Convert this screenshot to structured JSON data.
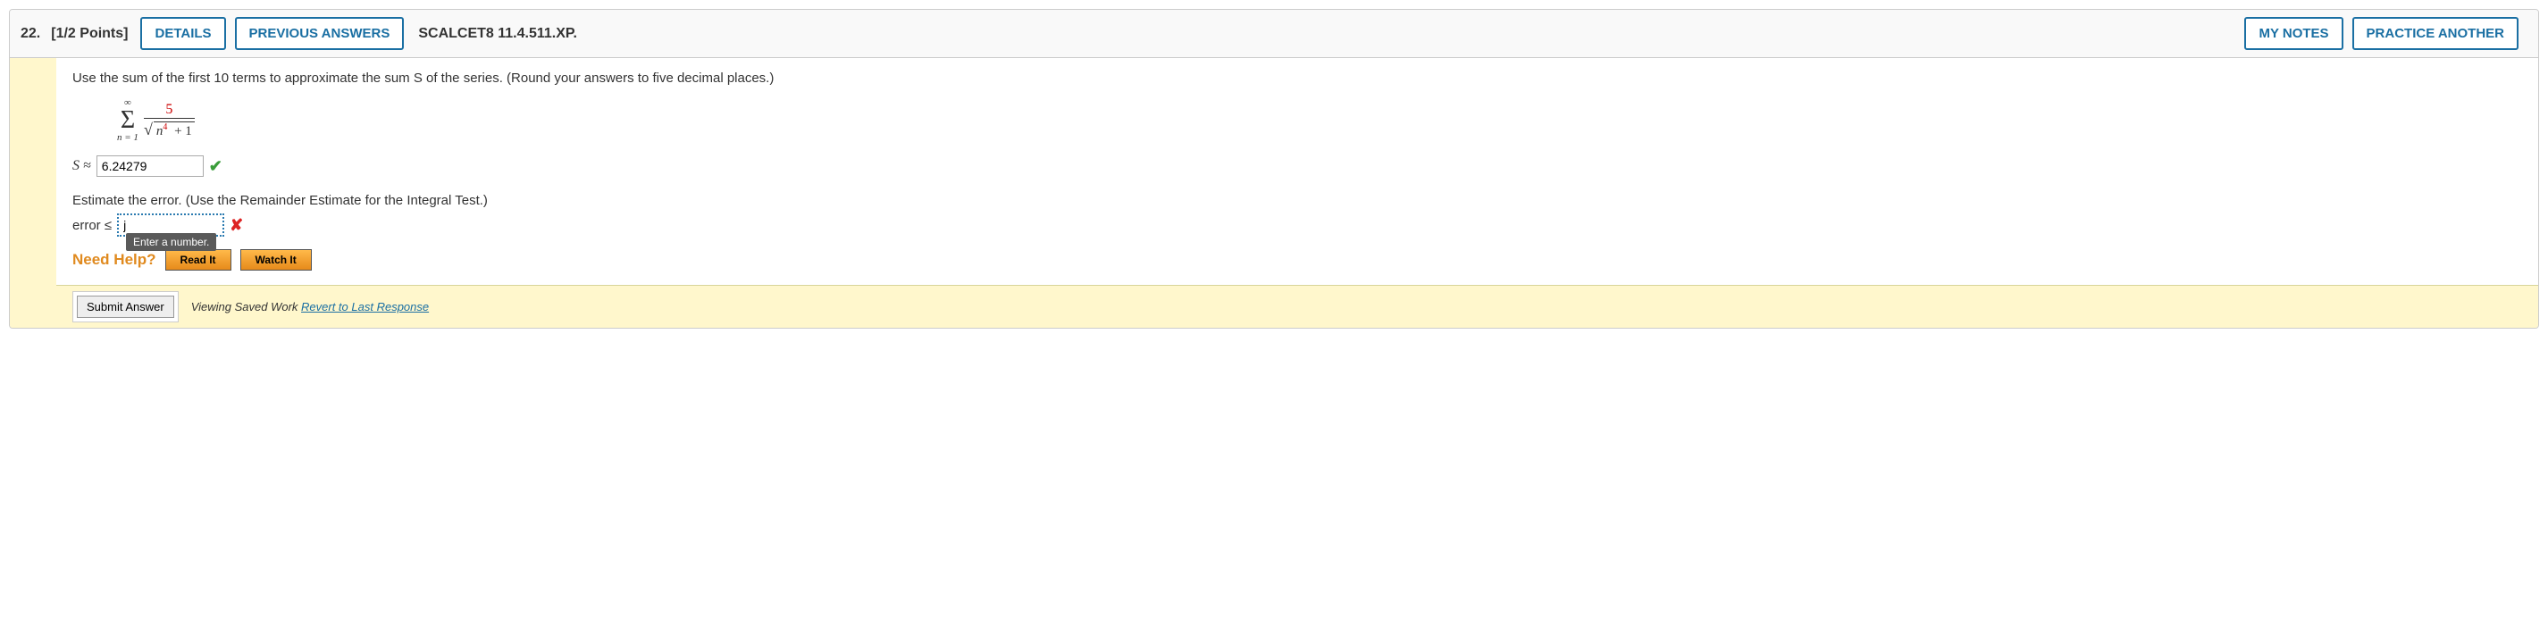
{
  "header": {
    "number": "22.",
    "points": "[1/2 Points]",
    "details": "DETAILS",
    "previous": "PREVIOUS ANSWERS",
    "reference": "SCALCET8 11.4.511.XP.",
    "my_notes": "MY NOTES",
    "practice": "PRACTICE ANOTHER"
  },
  "body": {
    "instruction": "Use the sum of the first 10 terms to approximate the sum S of the series. (Round your answers to five decimal places.)",
    "formula": {
      "sigma_top": "∞",
      "sigma_bottom": "n = 1",
      "numerator": "5",
      "den_n": "n",
      "den_exp": "4",
      "den_plus": " + 1"
    },
    "answer1": {
      "label": "S ≈",
      "value": "6.24279"
    },
    "instruction2": "Estimate the error. (Use the Remainder Estimate for the Integral Test.)",
    "answer2": {
      "label": "error ≤",
      "value": "j",
      "tooltip": "Enter a number."
    },
    "help": {
      "label": "Need Help?",
      "read": "Read It",
      "watch": "Watch It"
    }
  },
  "footer": {
    "submit": "Submit Answer",
    "saved": "Viewing Saved Work ",
    "revert": "Revert to Last Response"
  }
}
